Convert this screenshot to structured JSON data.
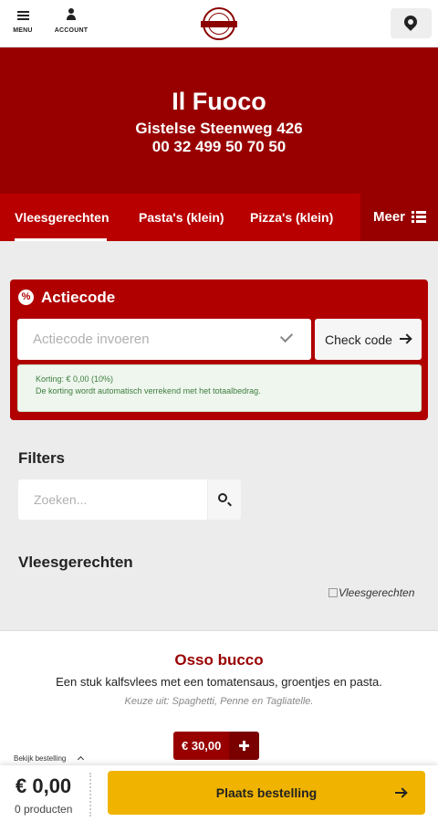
{
  "topbar": {
    "menu_label": "MENU",
    "account_label": "ACCOUNT"
  },
  "hero": {
    "name": "Il Fuoco",
    "address": "Gistelse Steenweg 426",
    "phone": "00 32 499 50 70 50",
    "background_color": "#980000"
  },
  "tabs": {
    "items": [
      {
        "label": "Vleesgerechten",
        "active": true
      },
      {
        "label": "Pasta's (klein)",
        "active": false
      },
      {
        "label": "Pizza's (klein)",
        "active": false
      }
    ],
    "more_label": "Meer"
  },
  "promo": {
    "title": "Actiecode",
    "input_placeholder": "Actiecode invoeren",
    "check_button": "Check code",
    "discount_line1": "Korting: € 0,00 (10%)",
    "discount_line2": "De korting wordt automatisch verrekend met het totaalbedrag."
  },
  "filters": {
    "heading": "Filters",
    "search_placeholder": "Zoeken..."
  },
  "category": {
    "heading": "Vleesgerechten",
    "image_alt": "Vleesgerechten"
  },
  "product": {
    "name": "Osso bucco",
    "description": "Een stuk kalfsvlees met een tomatensaus, groentjes en pasta.",
    "choice": "Keuze uit: Spaghetti, Penne en Tagliatelle.",
    "price": "€ 30,00"
  },
  "cart": {
    "view_order_label": "Bekijk bestelling",
    "total": "€ 0,00",
    "count": "0 producten",
    "place_order_label": "Plaats bestelling",
    "accent_color": "#f0b400"
  }
}
